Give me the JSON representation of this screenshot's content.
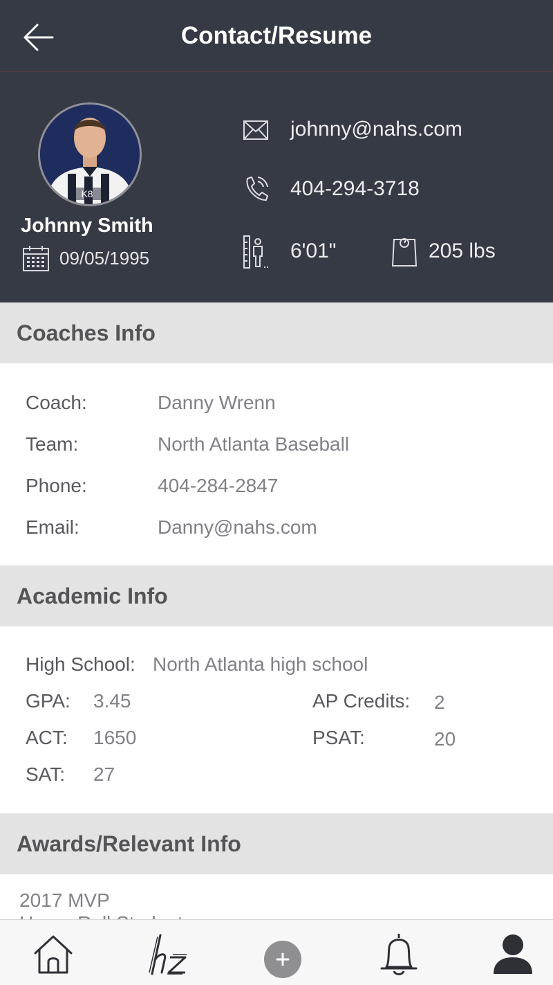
{
  "header": {
    "title": "Contact/Resume",
    "back_icon": "arrow-left-icon"
  },
  "profile": {
    "name": "Johnny Smith",
    "dob": "09/05/1995",
    "email": "johnny@nahs.com",
    "phone": "404-294-3718",
    "height": "6'01\"",
    "weight": "205 lbs",
    "avatar_jersey_text": "K8"
  },
  "coaches": {
    "title": "Coaches Info",
    "rows": [
      {
        "label": "Coach:",
        "value": "Danny Wrenn"
      },
      {
        "label": "Team:",
        "value": "North Atlanta Baseball"
      },
      {
        "label": "Phone:",
        "value": "404-284-2847"
      },
      {
        "label": "Email:",
        "value": "Danny@nahs.com"
      }
    ]
  },
  "academic": {
    "title": "Academic Info",
    "high_school_label": "High School:",
    "high_school_value": "North Atlanta high school",
    "gpa_label": "GPA:",
    "gpa_value": "3.45",
    "act_label": "ACT:",
    "act_value": "1650",
    "sat_label": "SAT:",
    "sat_value": "27",
    "ap_label": "AP Credits:",
    "ap_value": "2",
    "psat_label": "PSAT:",
    "psat_value": "20"
  },
  "awards": {
    "title": "Awards/Relevant Info",
    "items": [
      "2017 MVP",
      "Honor Roll Student"
    ]
  },
  "nav": {
    "items": [
      {
        "icon": "home-icon"
      },
      {
        "icon": "hz-logo-icon"
      },
      {
        "icon": "plus-icon"
      },
      {
        "icon": "bell-icon"
      },
      {
        "icon": "user-icon"
      }
    ]
  },
  "colors": {
    "header_bg": "#363a44",
    "section_bg": "#e3e3e3",
    "nav_bg": "#f7f7f7"
  }
}
